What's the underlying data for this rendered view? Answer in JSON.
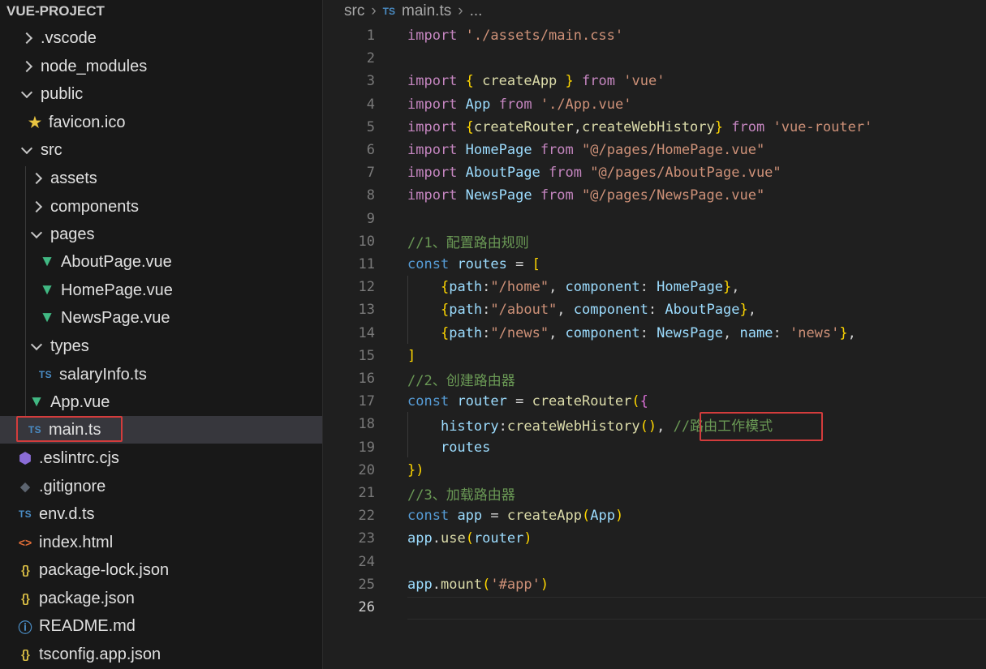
{
  "explorer": {
    "title": "VUE-PROJECT",
    "items": [
      {
        "label": ".vscode",
        "kind": "folder-collapsed"
      },
      {
        "label": "node_modules",
        "kind": "folder-collapsed"
      },
      {
        "label": "public",
        "kind": "folder-expanded"
      },
      {
        "label": "favicon.ico",
        "kind": "file",
        "icon": "star-icon"
      },
      {
        "label": "src",
        "kind": "folder-expanded"
      },
      {
        "label": "assets",
        "kind": "folder-collapsed"
      },
      {
        "label": "components",
        "kind": "folder-collapsed"
      },
      {
        "label": "pages",
        "kind": "folder-expanded"
      },
      {
        "label": "AboutPage.vue",
        "kind": "file",
        "icon": "vue-icon"
      },
      {
        "label": "HomePage.vue",
        "kind": "file",
        "icon": "vue-icon"
      },
      {
        "label": "NewsPage.vue",
        "kind": "file",
        "icon": "vue-icon"
      },
      {
        "label": "types",
        "kind": "folder-expanded"
      },
      {
        "label": "salaryInfo.ts",
        "kind": "file",
        "icon": "ts-icon",
        "icon_text": "TS"
      },
      {
        "label": "App.vue",
        "kind": "file",
        "icon": "vue-icon"
      },
      {
        "label": "main.ts",
        "kind": "file",
        "icon": "ts-icon",
        "icon_text": "TS",
        "selected": true
      },
      {
        "label": ".eslintrc.cjs",
        "kind": "file",
        "icon": "eslint-icon"
      },
      {
        "label": ".gitignore",
        "kind": "file",
        "icon": "git-icon"
      },
      {
        "label": "env.d.ts",
        "kind": "file",
        "icon": "ts-icon",
        "icon_text": "TS"
      },
      {
        "label": "index.html",
        "kind": "file",
        "icon": "html-icon",
        "icon_text": "<>"
      },
      {
        "label": "package-lock.json",
        "kind": "file",
        "icon": "json-icon",
        "icon_text": "{}"
      },
      {
        "label": "package.json",
        "kind": "file",
        "icon": "json-icon",
        "icon_text": "{}"
      },
      {
        "label": "README.md",
        "kind": "file",
        "icon": "info-icon"
      },
      {
        "label": "tsconfig.app.json",
        "kind": "file",
        "icon": "json-icon",
        "icon_text": "{}"
      }
    ]
  },
  "breadcrumb": {
    "items": [
      "src",
      "main.ts",
      "..."
    ],
    "file_icon_text": "TS"
  },
  "editor": {
    "active_line": 26,
    "lines": [
      {
        "n": 1,
        "text": "import './assets/main.css'"
      },
      {
        "n": 2,
        "text": ""
      },
      {
        "n": 3,
        "text": "import { createApp } from 'vue'"
      },
      {
        "n": 4,
        "text": "import App from './App.vue'"
      },
      {
        "n": 5,
        "text": "import {createRouter,createWebHistory} from 'vue-router'"
      },
      {
        "n": 6,
        "text": "import HomePage from \"@/pages/HomePage.vue\""
      },
      {
        "n": 7,
        "text": "import AboutPage from \"@/pages/AboutPage.vue\""
      },
      {
        "n": 8,
        "text": "import NewsPage from \"@/pages/NewsPage.vue\""
      },
      {
        "n": 9,
        "text": ""
      },
      {
        "n": 10,
        "text": "//1、配置路由规则"
      },
      {
        "n": 11,
        "text": "const routes = ["
      },
      {
        "n": 12,
        "text": "    {path:\"/home\", component: HomePage},"
      },
      {
        "n": 13,
        "text": "    {path:\"/about\", component: AboutPage},"
      },
      {
        "n": 14,
        "text": "    {path:\"/news\", component: NewsPage, name: 'news'},"
      },
      {
        "n": 15,
        "text": "]"
      },
      {
        "n": 16,
        "text": "//2、创建路由器"
      },
      {
        "n": 17,
        "text": "const router = createRouter({"
      },
      {
        "n": 18,
        "text": "    history:createWebHistory(), //路由工作模式"
      },
      {
        "n": 19,
        "text": "    routes"
      },
      {
        "n": 20,
        "text": "})"
      },
      {
        "n": 21,
        "text": "//3、加载路由器"
      },
      {
        "n": 22,
        "text": "const app = createApp(App)"
      },
      {
        "n": 23,
        "text": "app.use(router)"
      },
      {
        "n": 24,
        "text": ""
      },
      {
        "n": 25,
        "text": "app.mount('#app')"
      },
      {
        "n": 26,
        "text": ""
      }
    ]
  },
  "colors": {
    "keyword": "#c586c0",
    "declaration": "#569cd6",
    "string": "#ce9178",
    "variable": "#9cdcfe",
    "function": "#dcdcaa",
    "comment": "#6a9955",
    "highlight_box": "#d33c3c"
  }
}
